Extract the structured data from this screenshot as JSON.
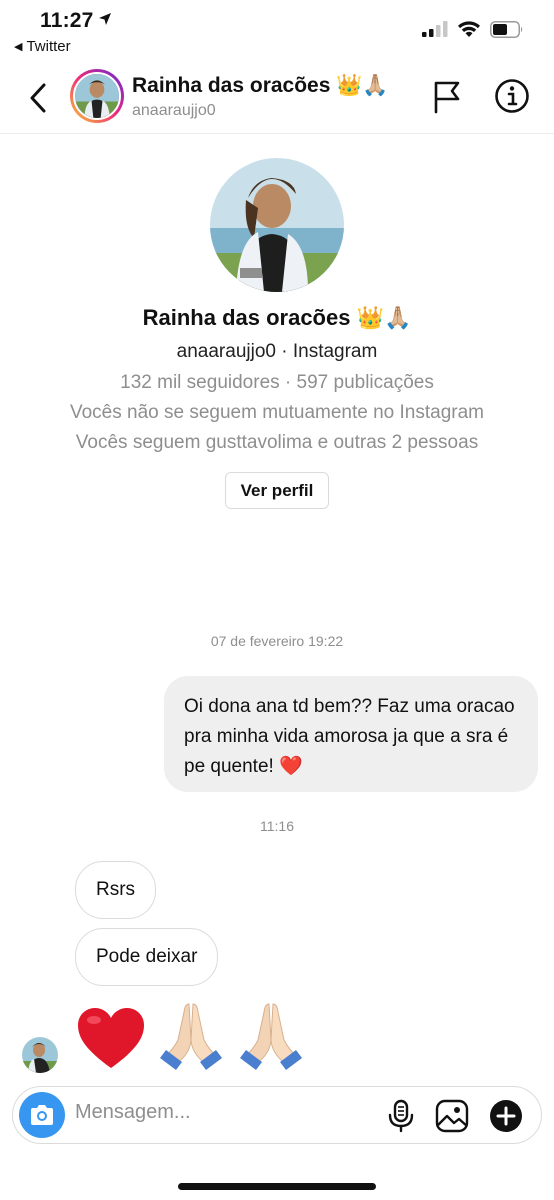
{
  "status_bar": {
    "time": "11:27",
    "back_app": "Twitter"
  },
  "header": {
    "title": "Rainha das oracões 👑🙏🏼",
    "username": "anaaraujjo0"
  },
  "profile": {
    "name": "Rainha das oracões 👑🙏🏼",
    "handle_line": "anaaraujjo0 · Instagram",
    "stats": "132 mil seguidores · 597 publicações",
    "mutual": "Vocês não se seguem mutuamente no Instagram",
    "follow": "Vocês seguem gusttavolima e outras 2 pessoas",
    "view_profile_label": "Ver perfil"
  },
  "messages": {
    "timestamp_1": "07 de fevereiro 19:22",
    "outgoing_1": "Oi dona ana td bem?? Faz uma oracao pra minha vida amorosa ja que a sra é pe quente! ❤️",
    "timestamp_2": "11:16",
    "incoming_1": "Rsrs",
    "incoming_2": "Pode deixar",
    "incoming_emoji": [
      "❤️",
      "🙏🏼",
      "🙏🏼"
    ]
  },
  "composer": {
    "placeholder": "Mensagem..."
  },
  "colors": {
    "accent": "#3797f0",
    "bubble_outgoing": "#efefef",
    "muted_text": "#8e8e8e",
    "border": "#dbdbdb"
  }
}
